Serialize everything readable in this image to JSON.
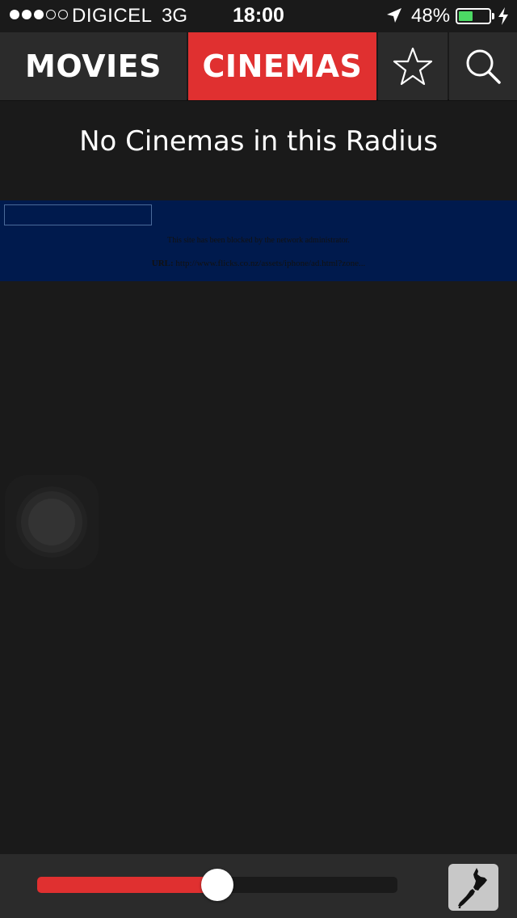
{
  "status_bar": {
    "signal": {
      "filled": 3,
      "total": 5
    },
    "carrier": "DIGICEL",
    "network": "3G",
    "time": "18:00",
    "battery_percent_label": "48%",
    "battery_level": 0.48,
    "icons": [
      "location-arrow-icon",
      "charging-bolt-icon"
    ]
  },
  "nav": {
    "tabs": [
      {
        "label": "MOVIES",
        "active": false
      },
      {
        "label": "CINEMAS",
        "active": true
      }
    ],
    "favorites_icon": "star-icon",
    "search_icon": "search-icon"
  },
  "message": "No Cinemas in this Radius",
  "ad": {
    "blocked_text": "This site has been blocked by the network administrator.",
    "url_label": "URL:",
    "url_value": "http://www.flicks.co.nz/assets/iphone/ad.html?zone..."
  },
  "toolbar": {
    "radius_slider_value": 0.5,
    "map_button_icon": "new-zealand-map-icon"
  },
  "colors": {
    "accent": "#e03030",
    "background": "#1a1a1a",
    "bar": "#2b2b2b",
    "ad_background": "#001a4d",
    "battery": "#4cd964"
  }
}
